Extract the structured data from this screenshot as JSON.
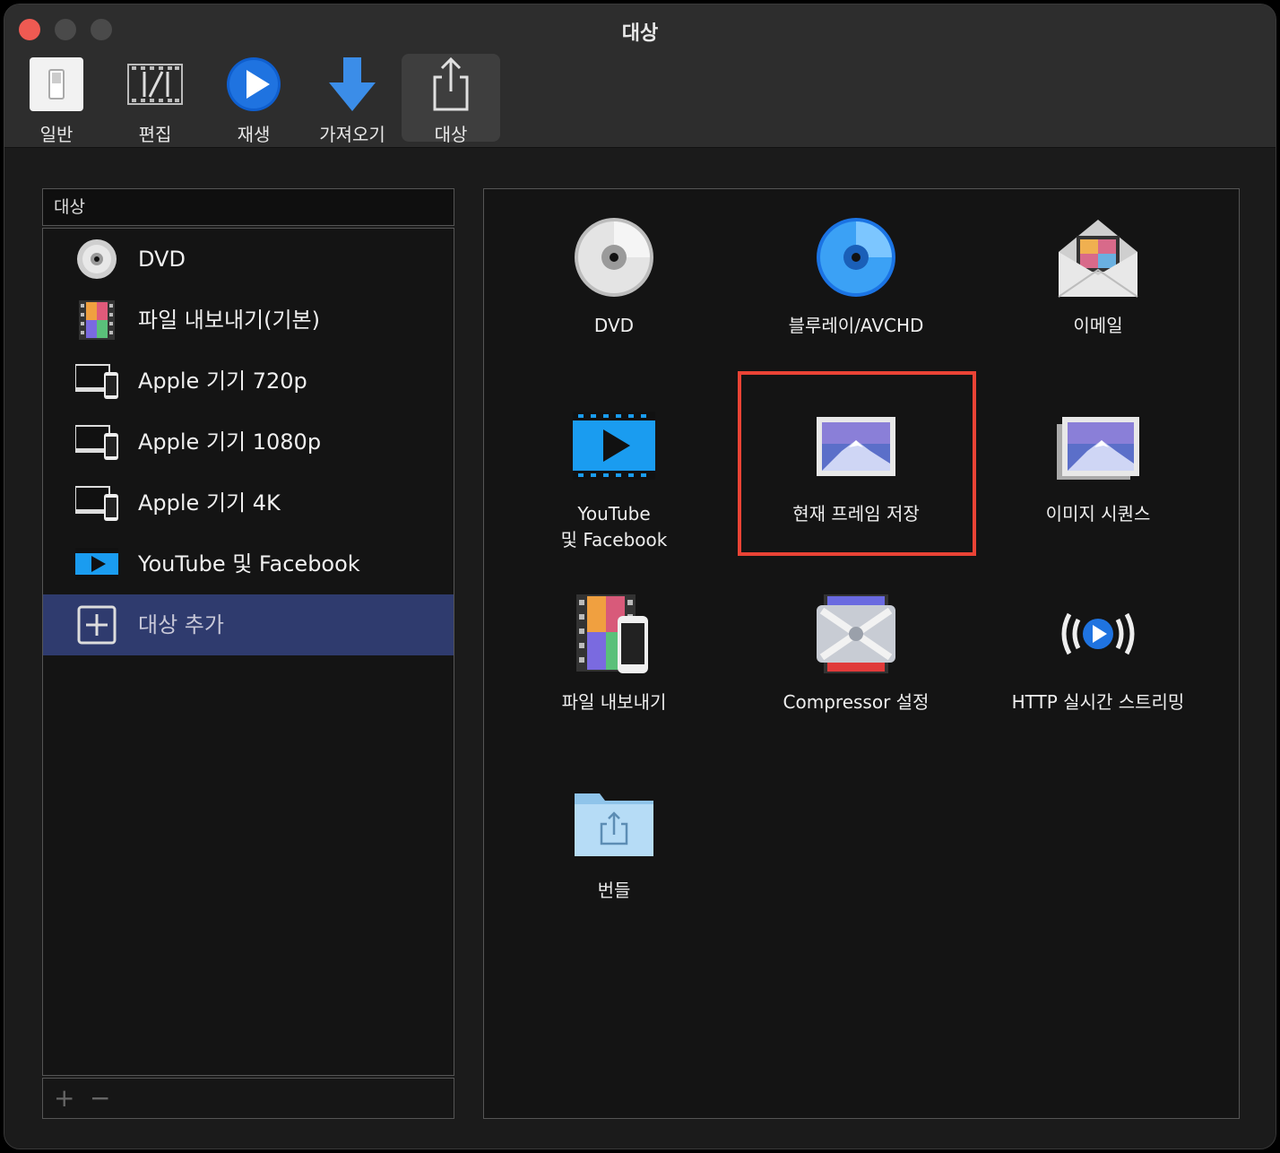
{
  "window": {
    "title": "대상"
  },
  "toolbar": {
    "items": [
      {
        "label": "일반",
        "icon": "switch-icon"
      },
      {
        "label": "편집",
        "icon": "film-strip-icon"
      },
      {
        "label": "재생",
        "icon": "play-circle-icon"
      },
      {
        "label": "가져오기",
        "icon": "download-arrow-icon"
      },
      {
        "label": "대상",
        "icon": "share-icon",
        "active": true
      }
    ]
  },
  "sidebar": {
    "header": "대상",
    "items": [
      {
        "label": "DVD",
        "icon": "dvd-disc-icon"
      },
      {
        "label": "파일 내보내기(기본)",
        "icon": "film-frame-icon"
      },
      {
        "label": "Apple 기기 720p",
        "icon": "apple-devices-icon"
      },
      {
        "label": "Apple 기기 1080p",
        "icon": "apple-devices-icon"
      },
      {
        "label": "Apple 기기 4K",
        "icon": "apple-devices-icon"
      },
      {
        "label": "YouTube 및 Facebook",
        "icon": "video-play-icon"
      },
      {
        "label": "대상 추가",
        "icon": "add-square-icon",
        "selected": true
      }
    ],
    "footer": {
      "add": "+",
      "remove": "−"
    }
  },
  "destinations": [
    {
      "label": "DVD",
      "icon": "dvd-disc-icon"
    },
    {
      "label": "블루레이/AVCHD",
      "icon": "bluray-disc-icon"
    },
    {
      "label": "이메일",
      "icon": "email-envelope-icon"
    },
    {
      "label": "YouTube\n및 Facebook",
      "icon": "video-play-icon"
    },
    {
      "label": "현재 프레임 저장",
      "icon": "photo-frame-icon",
      "highlighted": true
    },
    {
      "label": "이미지 시퀀스",
      "icon": "photo-stack-icon"
    },
    {
      "label": "파일 내보내기",
      "icon": "film-phone-icon"
    },
    {
      "label": "Compressor 설정",
      "icon": "compressor-icon"
    },
    {
      "label": "HTTP 실시간 스트리밍",
      "icon": "live-stream-icon"
    },
    {
      "label": "번들",
      "icon": "share-folder-icon"
    }
  ],
  "colors": {
    "highlight": "#ea4335",
    "selection": "#2f3b6e",
    "accent": "#2b8ef0"
  }
}
